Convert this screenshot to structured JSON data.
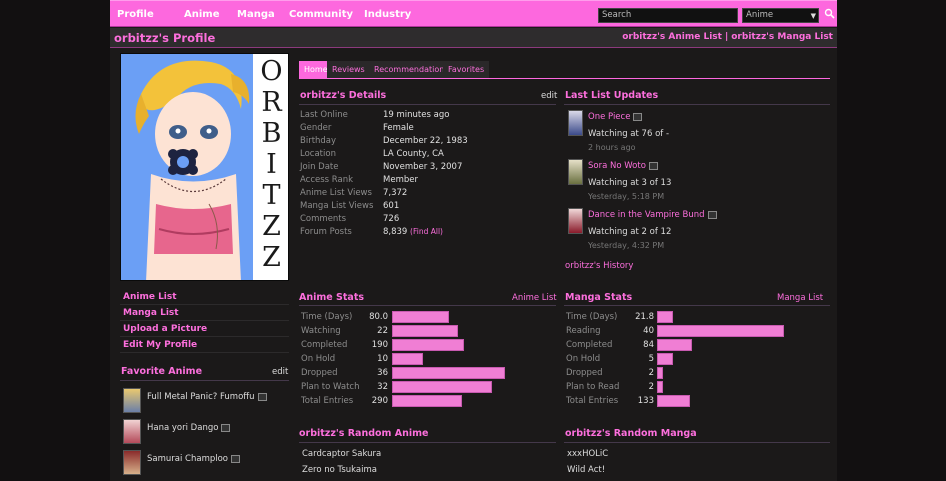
{
  "nav": {
    "items": [
      "Profile",
      "Anime",
      "Manga",
      "Community",
      "Industry"
    ],
    "search_placeholder": "Search",
    "select_value": "Anime"
  },
  "header": {
    "title": "orbitzz's Profile",
    "anime_list_link": "orbitzz's Anime List",
    "separator": "|",
    "manga_list_link": "orbitzz's Manga List"
  },
  "avatar": {
    "letters": [
      "O",
      "R",
      "B",
      "I",
      "T",
      "Z",
      "Z"
    ]
  },
  "left_nav": [
    "Anime List",
    "Manga List",
    "Upload a Picture",
    "Edit My Profile"
  ],
  "favorite_anime": {
    "title": "Favorite Anime",
    "edit": "edit",
    "items": [
      "Full Metal Panic? Fumoffu",
      "Hana yori Dango",
      "Samurai Champloo"
    ]
  },
  "tabs": [
    "Home",
    "Reviews",
    "Recommendations",
    "Favorites"
  ],
  "details": {
    "title": "orbitzz's Details",
    "edit": "edit",
    "rows": [
      {
        "label": "Last Online",
        "value": "19 minutes ago"
      },
      {
        "label": "Gender",
        "value": "Female"
      },
      {
        "label": "Birthday",
        "value": "December 22, 1983"
      },
      {
        "label": "Location",
        "value": "LA County, CA"
      },
      {
        "label": "Join Date",
        "value": "November 3, 2007"
      },
      {
        "label": "Access Rank",
        "value": "Member"
      },
      {
        "label": "Anime List Views",
        "value": "7,372"
      },
      {
        "label": "Manga List Views",
        "value": "601"
      },
      {
        "label": "Comments",
        "value": "726"
      },
      {
        "label": "Forum Posts",
        "value": "8,839"
      }
    ],
    "find_all": "(Find All)"
  },
  "updates": {
    "title": "Last List Updates",
    "items": [
      {
        "title": "One Piece",
        "status": "Watching at 76 of -",
        "time": "2 hours ago"
      },
      {
        "title": "Sora No Woto",
        "status": "Watching at 3 of 13",
        "time": "Yesterday, 5:18 PM"
      },
      {
        "title": "Dance in the Vampire Bund",
        "status": "Watching at 2 of 12",
        "time": "Yesterday, 4:32 PM"
      }
    ],
    "history": "orbitzz's History"
  },
  "anime_stats": {
    "title": "Anime Stats",
    "link": "Anime List",
    "rows": [
      {
        "label": "Time (Days)",
        "value": "80.0",
        "fraction": 0.28
      },
      {
        "label": "Watching",
        "value": "22",
        "fraction": 0.32
      },
      {
        "label": "Completed",
        "value": "190",
        "fraction": 0.35
      },
      {
        "label": "On Hold",
        "value": "10",
        "fraction": 0.15
      },
      {
        "label": "Dropped",
        "value": "36",
        "fraction": 0.55
      },
      {
        "label": "Plan to Watch",
        "value": "32",
        "fraction": 0.49
      },
      {
        "label": "Total Entries",
        "value": "290",
        "fraction": 0.34
      }
    ]
  },
  "manga_stats": {
    "title": "Manga Stats",
    "link": "Manga List",
    "rows": [
      {
        "label": "Time (Days)",
        "value": "21.8",
        "fraction": 0.08
      },
      {
        "label": "Reading",
        "value": "40",
        "fraction": 0.62
      },
      {
        "label": "Completed",
        "value": "84",
        "fraction": 0.17
      },
      {
        "label": "On Hold",
        "value": "5",
        "fraction": 0.08
      },
      {
        "label": "Dropped",
        "value": "2",
        "fraction": 0.03
      },
      {
        "label": "Plan to Read",
        "value": "2",
        "fraction": 0.03
      },
      {
        "label": "Total Entries",
        "value": "133",
        "fraction": 0.16
      }
    ]
  },
  "random_anime": {
    "title": "orbitzz's Random Anime",
    "items": [
      "Cardcaptor Sakura",
      "Zero no Tsukaima"
    ]
  },
  "random_manga": {
    "title": "orbitzz's Random Manga",
    "items": [
      "xxxHOLiC",
      "Wild Act!"
    ]
  }
}
